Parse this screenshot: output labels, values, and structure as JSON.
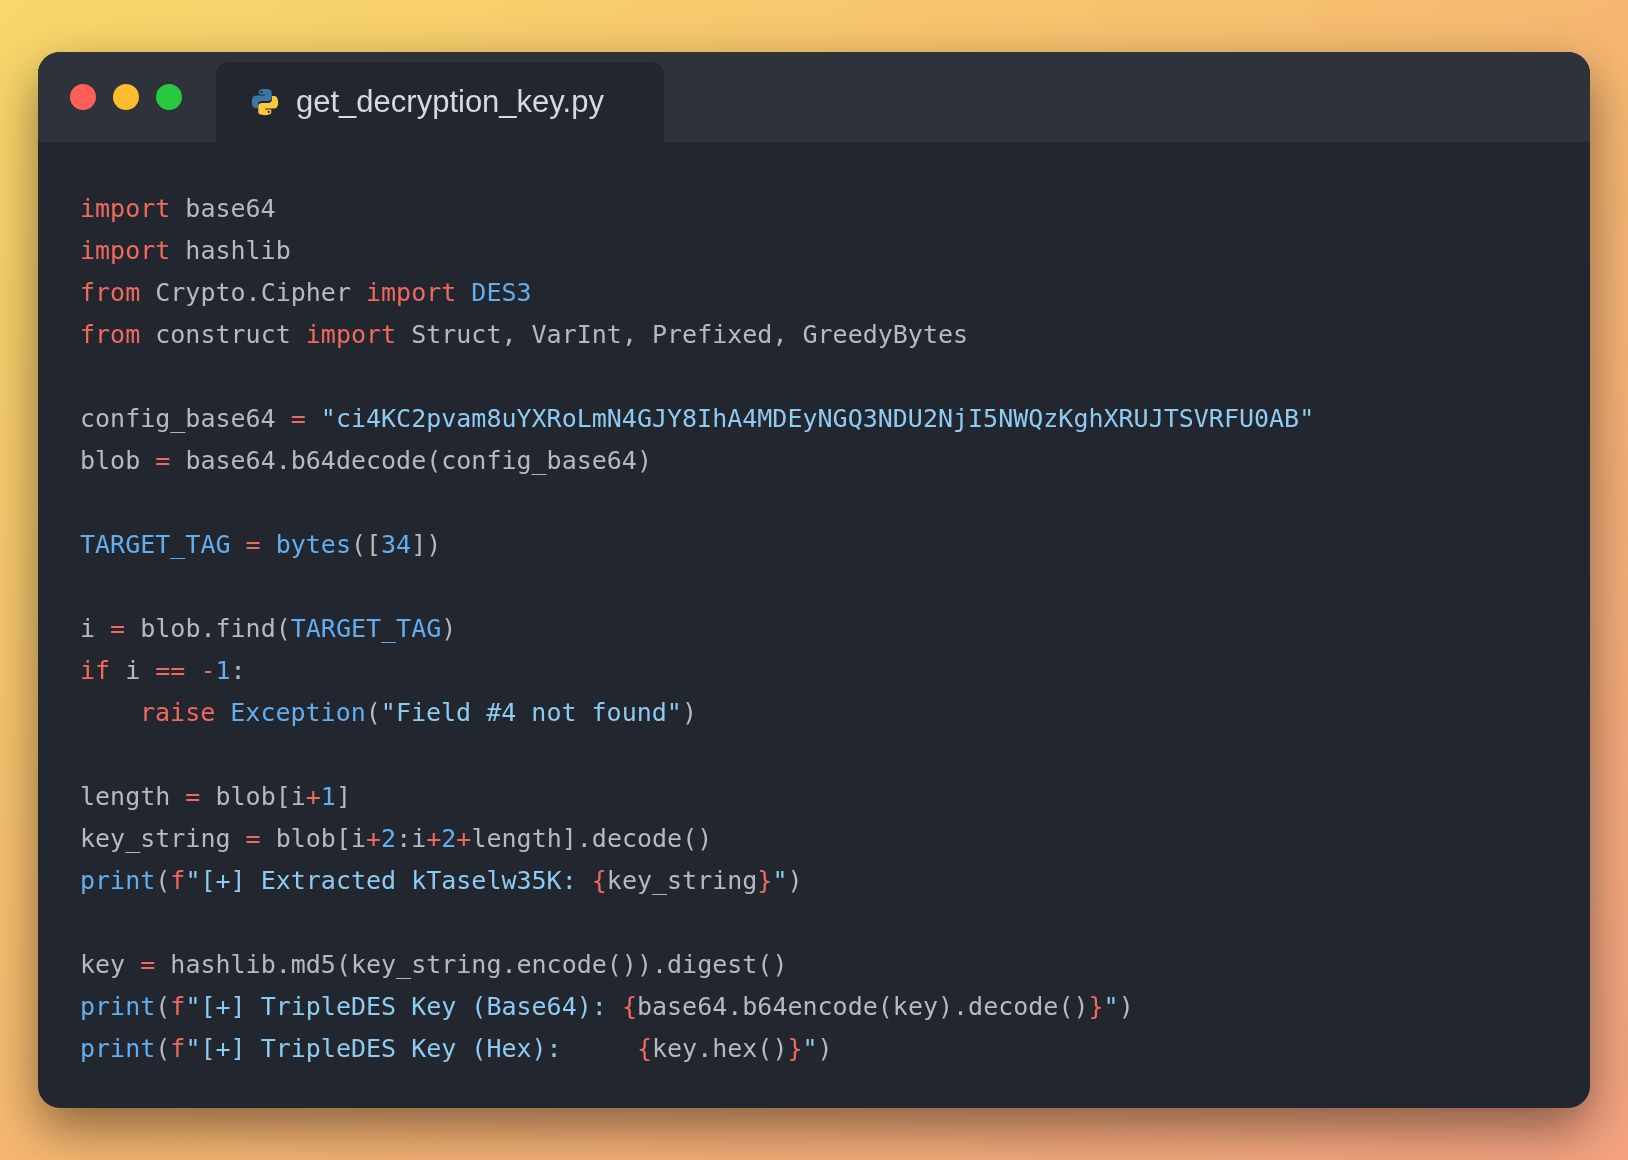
{
  "window": {
    "controls": [
      {
        "color": "#ff5f57"
      },
      {
        "color": "#febc2e"
      },
      {
        "color": "#28c840"
      }
    ]
  },
  "tab": {
    "label": "get_decryption_key.py",
    "selected": true
  },
  "code": [
    {
      "kind": "code",
      "tokens": [
        {
          "kind": "kw",
          "text": "import"
        },
        {
          "kind": "plain",
          "text": " base64"
        }
      ]
    },
    {
      "kind": "code",
      "tokens": [
        {
          "kind": "kw",
          "text": "import"
        },
        {
          "kind": "plain",
          "text": " hashlib"
        }
      ]
    },
    {
      "kind": "code",
      "tokens": [
        {
          "kind": "kw",
          "text": "from"
        },
        {
          "kind": "plain",
          "text": " Crypto.Cipher "
        },
        {
          "kind": "kw",
          "text": "import"
        },
        {
          "kind": "fn",
          "text": " DES3"
        }
      ]
    },
    {
      "kind": "code",
      "tokens": [
        {
          "kind": "kw",
          "text": "from"
        },
        {
          "kind": "plain",
          "text": " construct "
        },
        {
          "kind": "kw",
          "text": "import"
        },
        {
          "kind": "plain",
          "text": " Struct, VarInt, Prefixed, GreedyBytes"
        }
      ]
    },
    {
      "kind": "blank"
    },
    {
      "kind": "code",
      "tokens": [
        {
          "kind": "plain",
          "text": "config_base64 "
        },
        {
          "kind": "op",
          "text": "="
        },
        {
          "kind": "str",
          "text": " \"ci4KC2pvam8uYXRoLmN4GJY8IhA4MDEyNGQ3NDU2NjI5NWQzKghXRUJTSVRFU0AB\""
        }
      ]
    },
    {
      "kind": "code",
      "tokens": [
        {
          "kind": "plain",
          "text": "blob "
        },
        {
          "kind": "op",
          "text": "="
        },
        {
          "kind": "plain",
          "text": " base64.b64decode(config_base64)"
        }
      ]
    },
    {
      "kind": "blank"
    },
    {
      "kind": "code",
      "tokens": [
        {
          "kind": "fn",
          "text": "TARGET_TAG "
        },
        {
          "kind": "op",
          "text": "="
        },
        {
          "kind": "fn",
          "text": " bytes"
        },
        {
          "kind": "plain",
          "text": "(["
        },
        {
          "kind": "fn",
          "text": "34"
        },
        {
          "kind": "plain",
          "text": "])"
        }
      ]
    },
    {
      "kind": "blank"
    },
    {
      "kind": "code",
      "tokens": [
        {
          "kind": "plain",
          "text": "i "
        },
        {
          "kind": "op",
          "text": "="
        },
        {
          "kind": "plain",
          "text": " blob.find("
        },
        {
          "kind": "fn",
          "text": "TARGET_TAG"
        },
        {
          "kind": "plain",
          "text": ")"
        }
      ]
    },
    {
      "kind": "code",
      "tokens": [
        {
          "kind": "kw",
          "text": "if"
        },
        {
          "kind": "plain",
          "text": " i "
        },
        {
          "kind": "op",
          "text": "=="
        },
        {
          "kind": "op",
          "text": " -"
        },
        {
          "kind": "fn",
          "text": "1"
        },
        {
          "kind": "plain",
          "text": ":"
        }
      ],
      "children": [
        {
          "kind": "code",
          "tokens": [
            {
              "kind": "kw",
              "text": "raise"
            },
            {
              "kind": "fn",
              "text": " Exception"
            },
            {
              "kind": "plain",
              "text": "("
            },
            {
              "kind": "str",
              "text": "\"Field #4 not found\""
            },
            {
              "kind": "plain",
              "text": ")"
            }
          ]
        }
      ]
    },
    {
      "kind": "blank"
    },
    {
      "kind": "code",
      "tokens": [
        {
          "kind": "plain",
          "text": "length "
        },
        {
          "kind": "op",
          "text": "="
        },
        {
          "kind": "plain",
          "text": " blob[i"
        },
        {
          "kind": "op",
          "text": "+"
        },
        {
          "kind": "fn",
          "text": "1"
        },
        {
          "kind": "plain",
          "text": "]"
        }
      ]
    },
    {
      "kind": "code",
      "tokens": [
        {
          "kind": "plain",
          "text": "key_string "
        },
        {
          "kind": "op",
          "text": "="
        },
        {
          "kind": "plain",
          "text": " blob[i"
        },
        {
          "kind": "op",
          "text": "+"
        },
        {
          "kind": "fn",
          "text": "2"
        },
        {
          "kind": "plain",
          "text": ":i"
        },
        {
          "kind": "op",
          "text": "+"
        },
        {
          "kind": "fn",
          "text": "2"
        },
        {
          "kind": "op",
          "text": "+"
        },
        {
          "kind": "plain",
          "text": "length].decode()"
        }
      ]
    },
    {
      "kind": "code",
      "tokens": [
        {
          "kind": "fn",
          "text": "print"
        },
        {
          "kind": "plain",
          "text": "("
        },
        {
          "kind": "op",
          "text": "f"
        },
        {
          "kind": "str",
          "text": "\"[+] Extracted kTaselw35K: "
        },
        {
          "kind": "op",
          "text": "{"
        },
        {
          "kind": "plain",
          "text": "key_string"
        },
        {
          "kind": "op",
          "text": "}"
        },
        {
          "kind": "str",
          "text": "\""
        },
        {
          "kind": "plain",
          "text": ")"
        }
      ]
    },
    {
      "kind": "blank"
    },
    {
      "kind": "code",
      "tokens": [
        {
          "kind": "plain",
          "text": "key "
        },
        {
          "kind": "op",
          "text": "="
        },
        {
          "kind": "plain",
          "text": " hashlib.md5(key_string.encode()).digest()"
        }
      ]
    },
    {
      "kind": "code",
      "tokens": [
        {
          "kind": "fn",
          "text": "print"
        },
        {
          "kind": "plain",
          "text": "("
        },
        {
          "kind": "op",
          "text": "f"
        },
        {
          "kind": "str",
          "text": "\"[+] TripleDES Key (Base64): "
        },
        {
          "kind": "op",
          "text": "{"
        },
        {
          "kind": "plain",
          "text": "base64.b64encode(key).decode()"
        },
        {
          "kind": "op",
          "text": "}"
        },
        {
          "kind": "str",
          "text": "\""
        },
        {
          "kind": "plain",
          "text": ")"
        }
      ]
    },
    {
      "kind": "code",
      "tokens": [
        {
          "kind": "fn",
          "text": "print"
        },
        {
          "kind": "plain",
          "text": "("
        },
        {
          "kind": "op",
          "text": "f"
        },
        {
          "kind": "str",
          "text": "\"[+] TripleDES Key (Hex):     "
        },
        {
          "kind": "op",
          "text": "{"
        },
        {
          "kind": "plain",
          "text": "key.hex()"
        },
        {
          "kind": "op",
          "text": "}"
        },
        {
          "kind": "str",
          "text": "\""
        },
        {
          "kind": "plain",
          "text": ")"
        }
      ]
    }
  ]
}
